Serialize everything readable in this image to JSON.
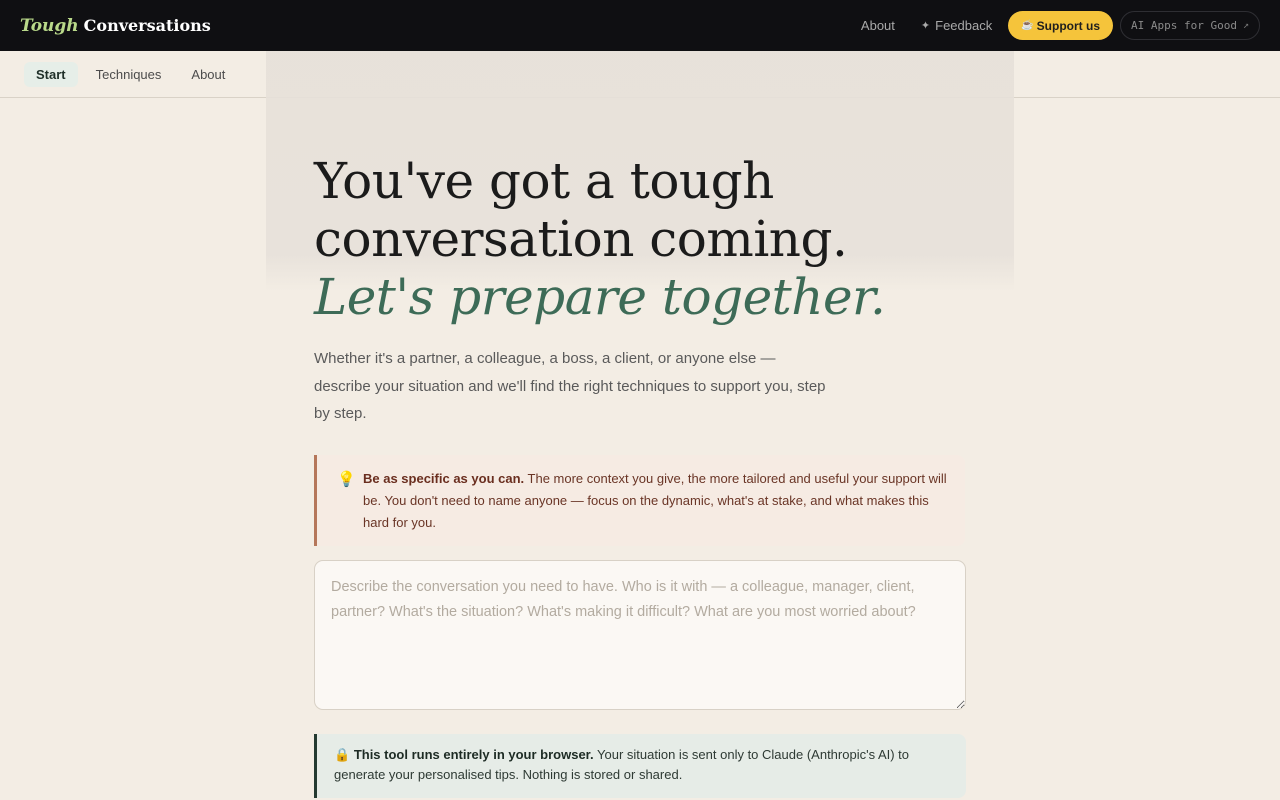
{
  "brand": {
    "italic": "Tough",
    "bold": "Conversations"
  },
  "topnav": {
    "about": "About",
    "feedback_icon": "sparkle-icon",
    "feedback": "Feedback",
    "support_icon": "cup-icon",
    "support": "Support us",
    "apps": "AI Apps for Good",
    "apps_icon": "external-arrow-icon"
  },
  "subnav": {
    "tabs": [
      {
        "label": "Start",
        "active": true
      },
      {
        "label": "Techniques"
      },
      {
        "label": "About"
      }
    ]
  },
  "hero": {
    "line1": "You've got a tough",
    "line2": "conversation coming.",
    "accent": "Let's prepare together.",
    "lead": "Whether it's a partner, a colleague, a boss, a client, or anyone else — describe your situation and we'll find the right techniques to support you, step by step."
  },
  "tip": {
    "icon": "lightbulb-icon",
    "bold": "Be as specific as you can.",
    "text": " The more context you give, the more tailored and useful your support will be. You don't need to name anyone — focus on the dynamic, what's at stake, and what makes this hard for you."
  },
  "situation": {
    "value": "",
    "placeholder": "Describe the conversation you need to have. Who is it with — a colleague, manager, client, partner? What's the situation? What's making it difficult? What are you most worried about?"
  },
  "privacy": {
    "icon": "lock-icon",
    "bold": "This tool runs entirely in your browser.",
    "text": " Your situation is sent only to Claude (Anthropic's AI) to generate your personalised tips. Nothing is stored or shared."
  },
  "colors": {
    "accent": "#3d6b57",
    "brand_green": "#b9d98a",
    "support_yellow": "#f5c43b",
    "topbar": "#0f0f12",
    "background": "#f3ede4"
  }
}
